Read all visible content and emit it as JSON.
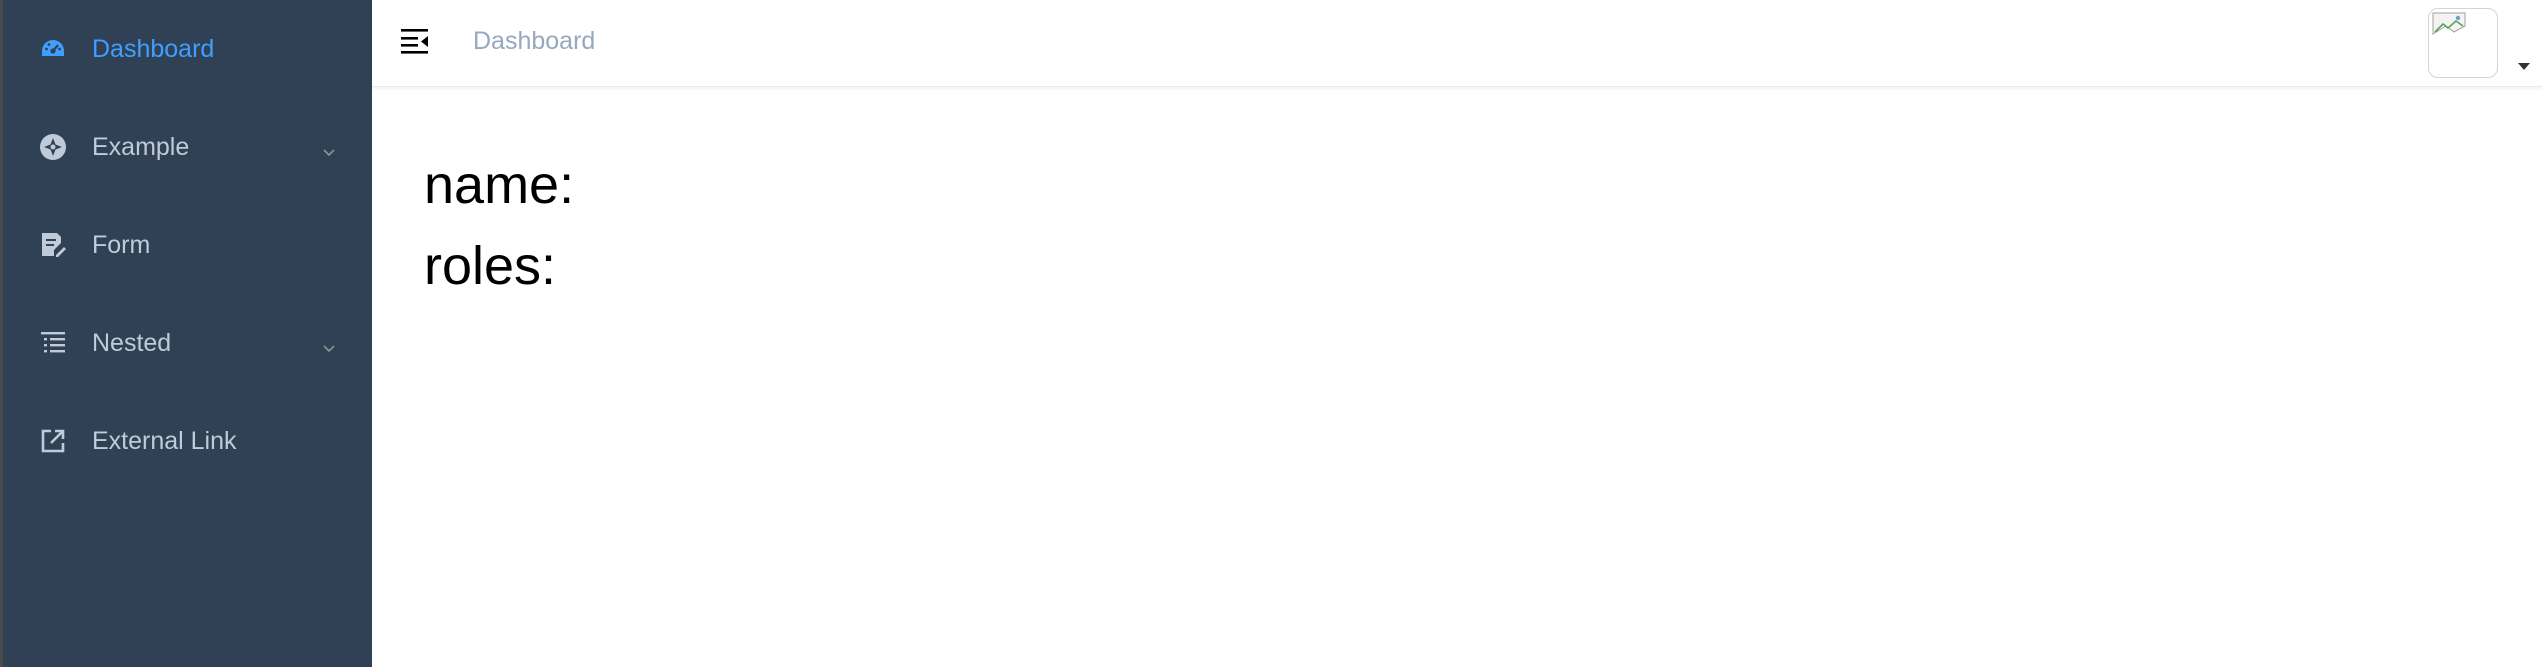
{
  "sidebar": {
    "items": [
      {
        "label": "Dashboard",
        "icon": "dashboard-icon",
        "active": true,
        "has_children": false
      },
      {
        "label": "Example",
        "icon": "example-icon",
        "active": false,
        "has_children": true
      },
      {
        "label": "Form",
        "icon": "form-icon",
        "active": false,
        "has_children": false
      },
      {
        "label": "Nested",
        "icon": "nested-icon",
        "active": false,
        "has_children": true
      },
      {
        "label": "External Link",
        "icon": "external-link-icon",
        "active": false,
        "has_children": false
      }
    ],
    "background_color": "#304156",
    "text_color": "#bfcbd9",
    "active_color": "#409eff"
  },
  "navbar": {
    "toggle_icon": "hamburger-icon",
    "breadcrumb": "Dashboard",
    "breadcrumb_color": "#97a8be",
    "avatar_icon": "broken-image-icon",
    "dropdown_icon": "caret-down-icon"
  },
  "main": {
    "name_label": "name:",
    "roles_label": "roles:"
  }
}
